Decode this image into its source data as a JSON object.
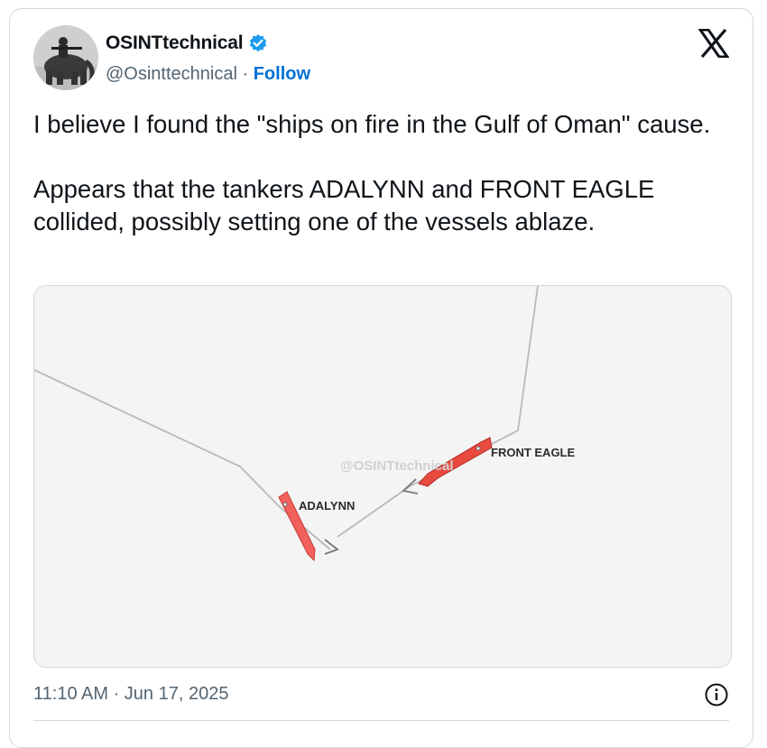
{
  "author": {
    "display_name": "OSINTtechnical",
    "handle": "@Osinttechnical",
    "separator": " · ",
    "follow_label": "Follow",
    "verified": true,
    "verified_color": "#1d9bf0"
  },
  "brand": {
    "icon": "x-logo-icon"
  },
  "tweet": {
    "text": "I believe I found the \"ships on fire in the Gulf of Oman\" cause.\n\nAppears that the tankers ADALYNN and FRONT EAGLE collided, possibly setting one of the vessels ablaze."
  },
  "media": {
    "watermark": "@OSINTtechnical",
    "vessel_1_label": "ADALYNN",
    "vessel_2_label": "FRONT EAGLE",
    "vessel_color": "#f2615c",
    "vessel_2_color": "#e84a40",
    "track_color": "#b9b9b9"
  },
  "footer": {
    "timestamp": "11:10 AM · Jun 17, 2025",
    "info_icon": "info-icon"
  }
}
